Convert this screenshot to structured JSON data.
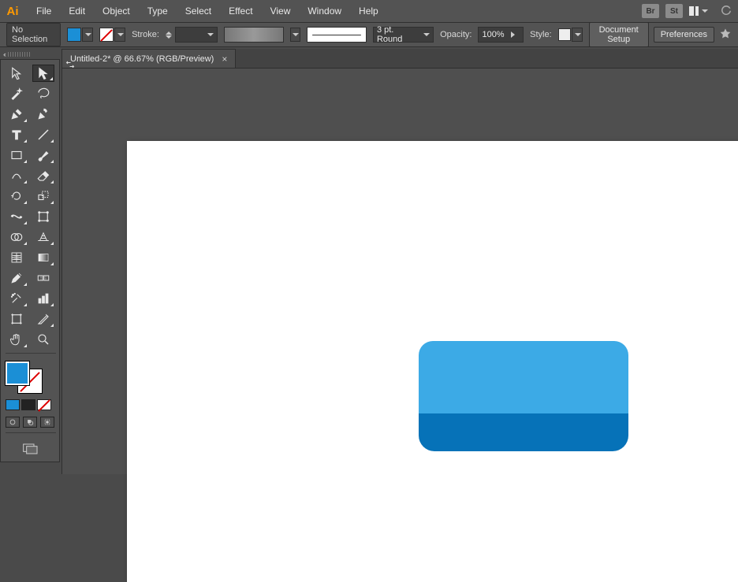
{
  "app": {
    "logo_text": "Ai"
  },
  "menu": {
    "items": [
      "File",
      "Edit",
      "Object",
      "Type",
      "Select",
      "Effect",
      "View",
      "Window",
      "Help"
    ],
    "badge_bridge": "Br",
    "badge_stock": "St"
  },
  "controlbar": {
    "selection_state": "No Selection",
    "stroke_label": "Stroke:",
    "brush_label": "3 pt. Round",
    "opacity_label": "Opacity:",
    "opacity_value": "100%",
    "style_label": "Style:",
    "doc_setup_btn": "Document Setup",
    "prefs_btn": "Preferences"
  },
  "document": {
    "tab_title": "Untitled-2* @ 66.67% (RGB/Preview)",
    "tab_close": "×"
  },
  "colors": {
    "fill": "#1b8fd6",
    "accent_top": "#3caae6",
    "accent_bottom": "#0672b8"
  }
}
